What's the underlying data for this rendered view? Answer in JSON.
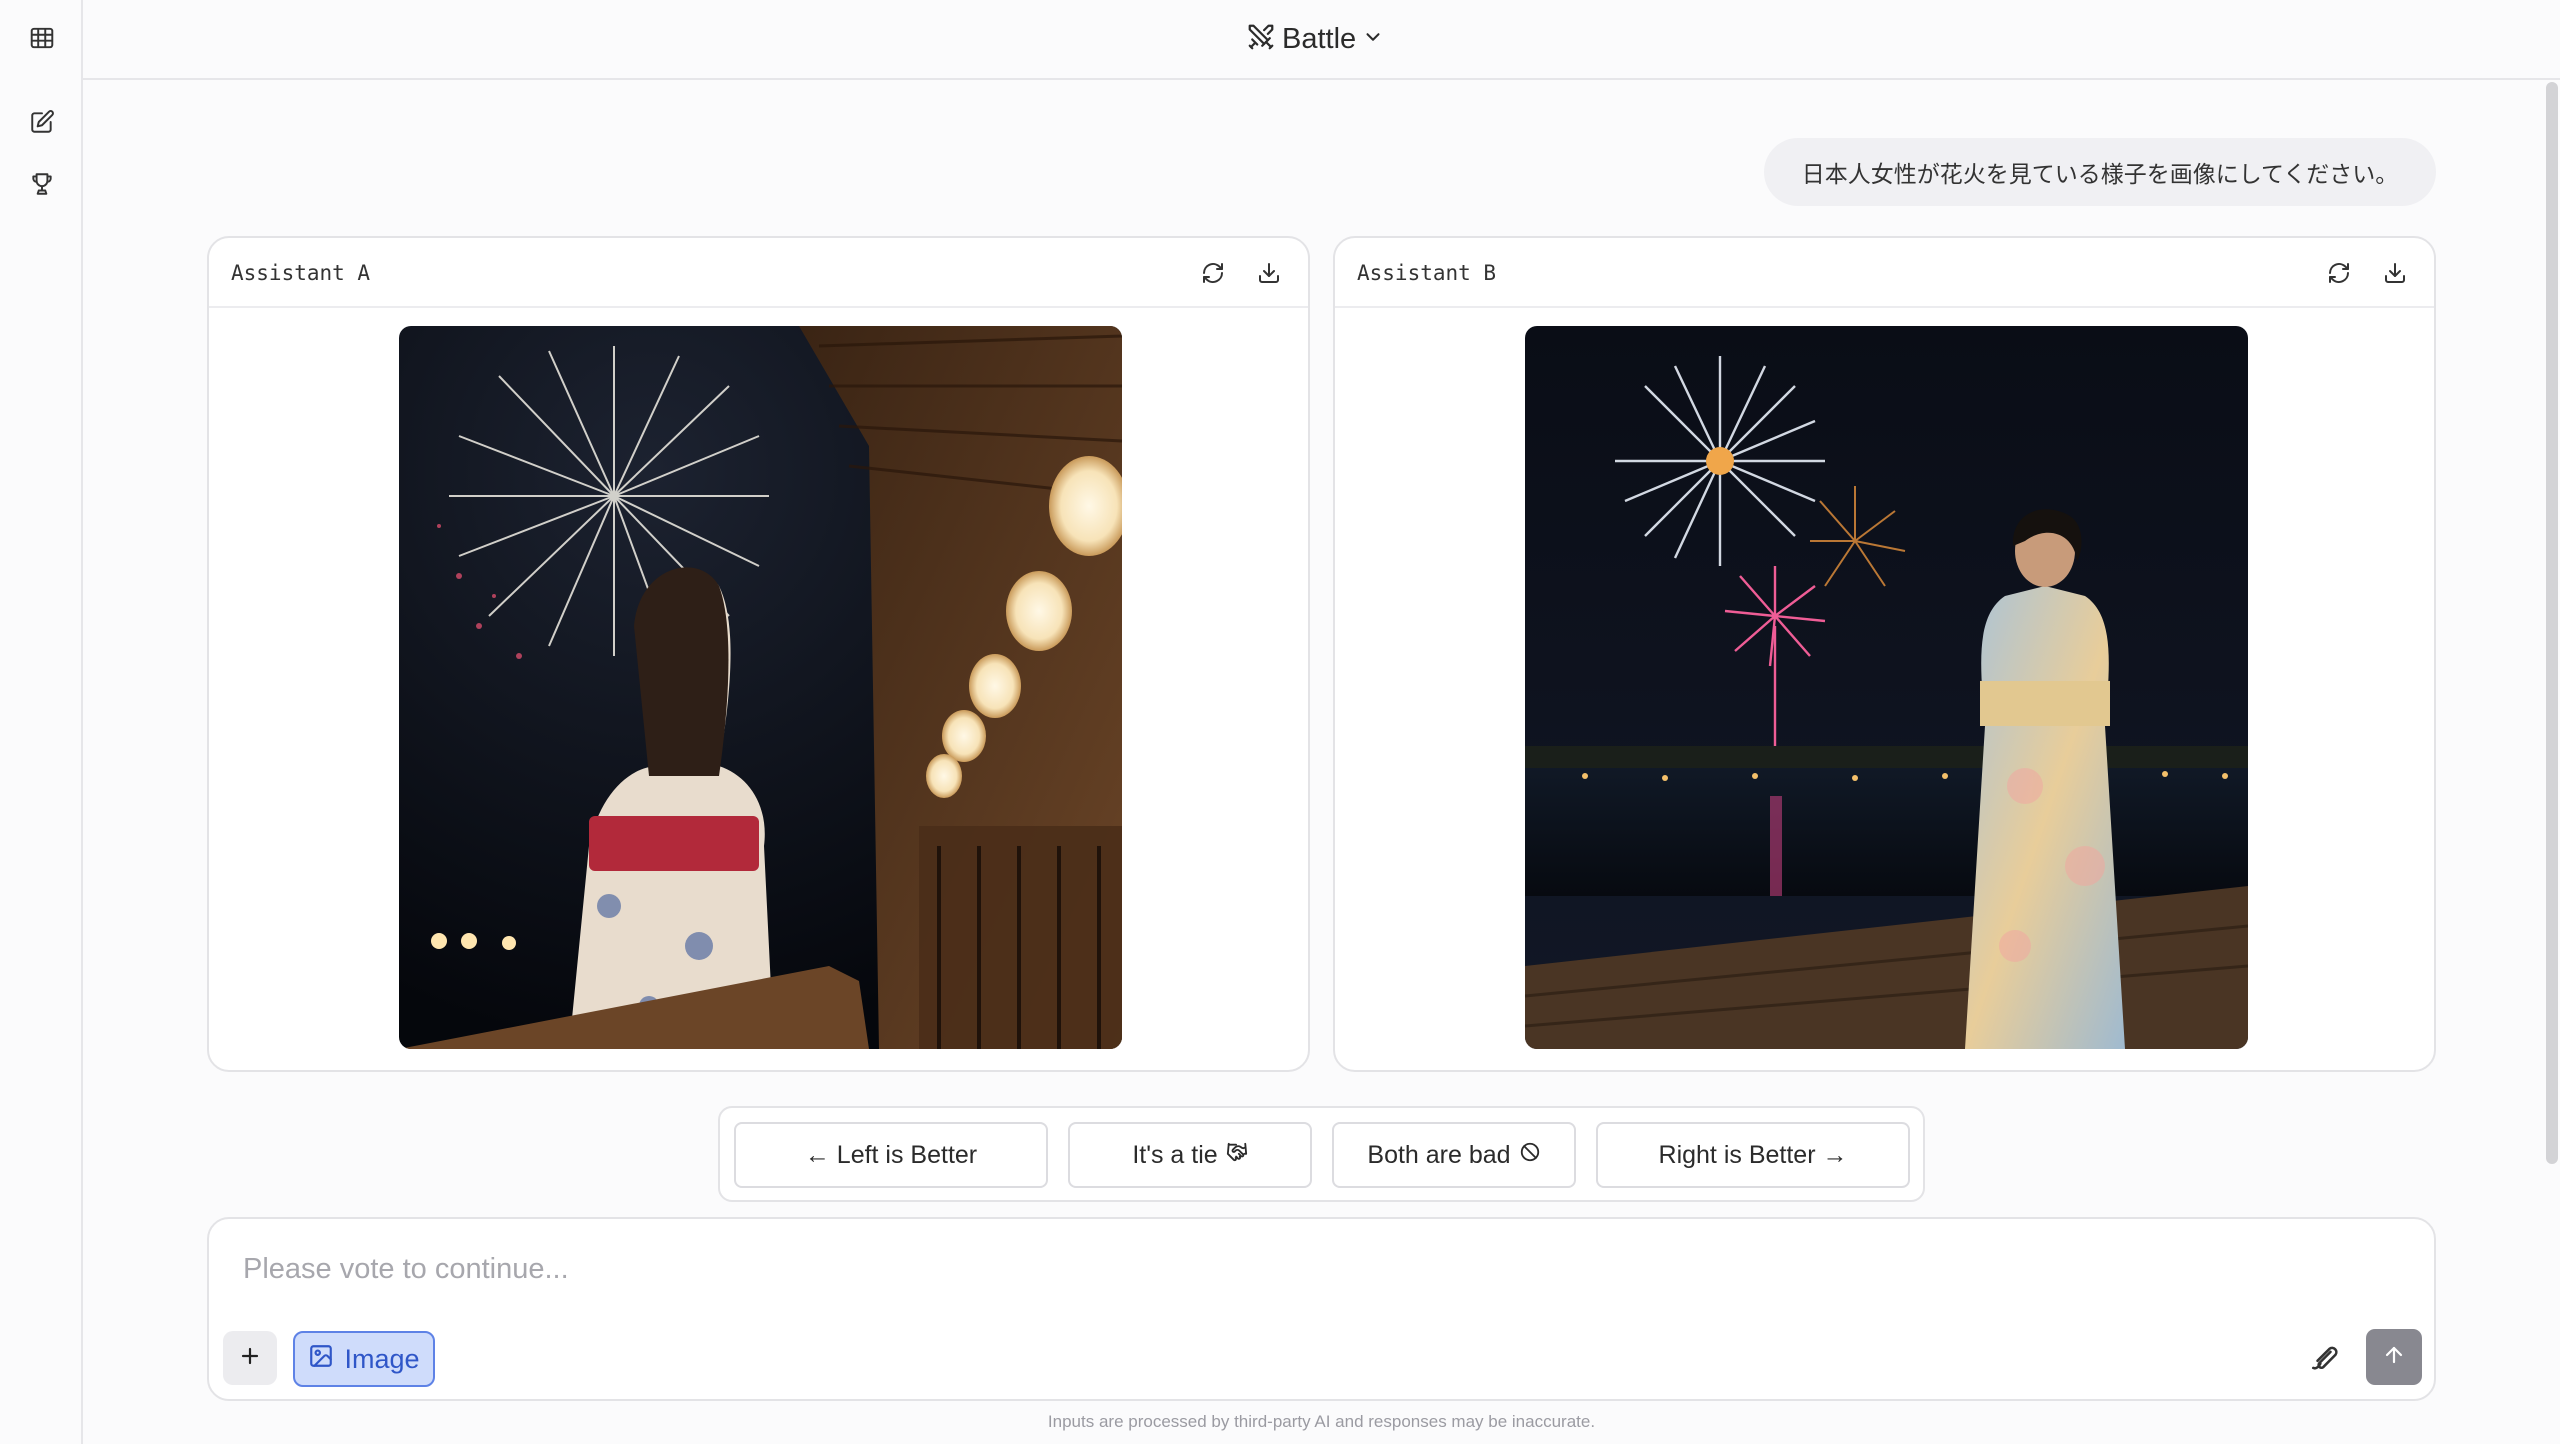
{
  "header": {
    "mode_label": "Battle"
  },
  "sidebar": {
    "items": [
      {
        "icon": "table-icon"
      },
      {
        "icon": "new-chat-icon"
      },
      {
        "icon": "trophy-icon"
      }
    ]
  },
  "conversation": {
    "user_prompt": "日本人女性が花火を見ている様子を画像にしてください。"
  },
  "panels": {
    "a": {
      "title": "Assistant A",
      "image_desc": "fireworks-woman-yukata-lanterns-veranda"
    },
    "b": {
      "title": "Assistant B",
      "image_desc": "fireworks-woman-kimono-lake-pier"
    }
  },
  "vote": {
    "left": "← Left is Better",
    "tie": "It's a tie",
    "both_bad": "Both are bad",
    "right": "Right is Better →"
  },
  "composer": {
    "placeholder": "Please vote to continue...",
    "image_toggle_label": "Image"
  },
  "footer": {
    "disclaimer": "Inputs are processed by third-party AI and responses may be inaccurate."
  },
  "colors": {
    "accent": "#5e82e6",
    "accent_bg": "#cfdcfb",
    "border": "#e3e3e6",
    "send_button": "#888890"
  }
}
